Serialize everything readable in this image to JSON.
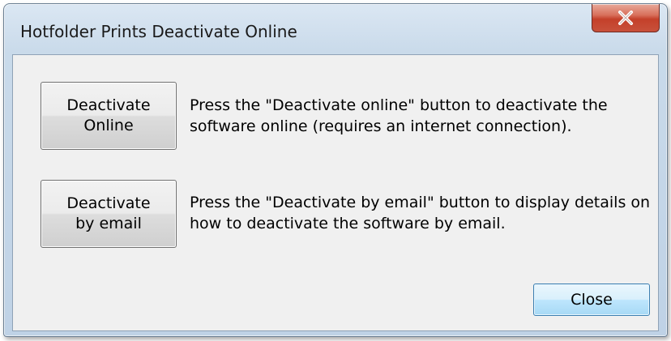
{
  "window": {
    "title": "Hotfolder Prints Deactivate Online",
    "close_icon": "close-x-icon"
  },
  "online": {
    "button_label": "Deactivate Online",
    "description": "Press the \"Deactivate online\" button to deactivate the software online (requires an internet connection)."
  },
  "email": {
    "button_label": "Deactivate by email",
    "description": "Press the \"Deactivate by email\" button to display details on how to deactivate the software by email."
  },
  "footer": {
    "close_label": "Close"
  },
  "colors": {
    "title_close_button": "#c4402a",
    "default_button_border": "#3c7fb1",
    "client_background": "#f0f0f0"
  }
}
